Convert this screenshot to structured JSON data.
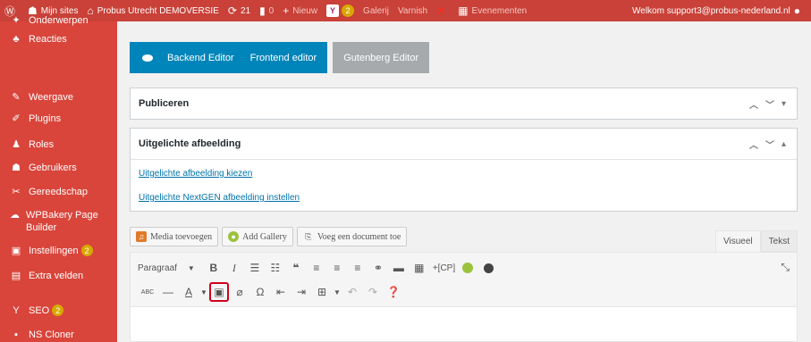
{
  "adminbar": {
    "wp_logo_icon": "wordpress-icon",
    "my_sites": "Mijn sites",
    "site_name": "Probus Utrecht DEMOVERSIE",
    "updates_count": "21",
    "comments_count": "0",
    "new_label": "Nieuw",
    "seo_count": "2",
    "gallery_label": "Galerij",
    "varnish_label": "Varnish",
    "events_label": "Evenementen",
    "welcome": "Welkom support3@probus-nederland.nl"
  },
  "sidebar": {
    "items": [
      {
        "label": "Onderwerpen",
        "icon": "tag-icon"
      },
      {
        "label": "Reacties",
        "icon": "comments-icon"
      },
      {
        "label": "Weergave",
        "icon": "appearance-icon"
      },
      {
        "label": "Plugins",
        "icon": "plugins-icon"
      },
      {
        "label": "Roles",
        "icon": "roles-icon"
      },
      {
        "label": "Gebruikers",
        "icon": "users-icon"
      },
      {
        "label": "Gereedschap",
        "icon": "tools-icon"
      },
      {
        "label": "WPBakery Page Builder",
        "icon": "wpbakery-icon"
      },
      {
        "label": "Instellingen",
        "icon": "settings-icon",
        "count": "2"
      },
      {
        "label": "Extra velden",
        "icon": "fields-icon"
      },
      {
        "label": "SEO",
        "icon": "yoast-icon",
        "count": "2"
      },
      {
        "label": "NS Cloner",
        "icon": "cloner-icon"
      }
    ]
  },
  "editor_switch": {
    "backend": "Backend Editor",
    "frontend": "Frontend editor",
    "gutenberg": "Gutenberg Editor"
  },
  "publish_box": {
    "title": "Publiceren"
  },
  "featured_box": {
    "title": "Uitgelichte afbeelding",
    "link1": "Uitgelichte afbeelding kiezen",
    "link2": "Uitgelichte NextGEN afbeelding instellen"
  },
  "media_buttons": {
    "add_media": "Media toevoegen",
    "add_gallery": "Add Gallery",
    "add_document": "Voeg een document toe"
  },
  "editor_tabs": {
    "visual": "Visueel",
    "text": "Tekst"
  },
  "toolbar": {
    "format_select": "Paragraaf",
    "cp_label": "+[CP]",
    "abc_label": "ABC"
  },
  "colors": {
    "adminbar": "#c94138",
    "sidebar": "#d9453b",
    "primary": "#0085ba",
    "highlight": "#d0021b"
  }
}
